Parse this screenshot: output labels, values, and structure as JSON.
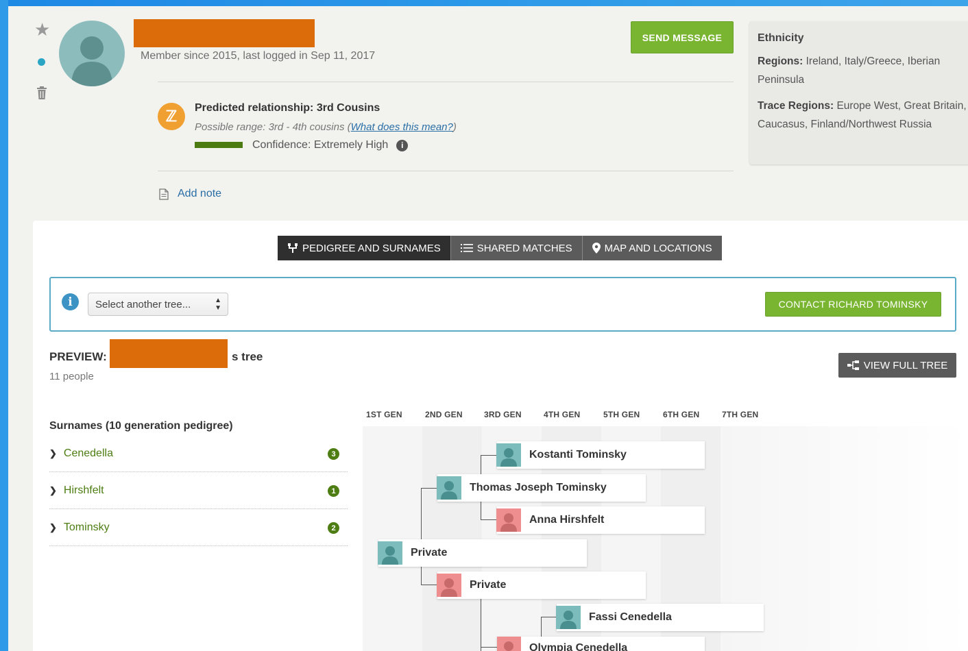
{
  "profile": {
    "member_since": "Member since 2015, last logged in Sep 11, 2017",
    "send_message": "SEND MESSAGE"
  },
  "relationship": {
    "predicted": "Predicted relationship: 3rd Cousins",
    "range_prefix": "Possible range: 3rd - 4th cousins (",
    "range_link": "What does this mean?",
    "range_suffix": ")",
    "confidence": "Confidence: Extremely High"
  },
  "note": {
    "add_note": "Add note"
  },
  "ethnicity": {
    "title": "Ethnicity",
    "regions_label": "Regions:",
    "regions": "Ireland, Italy/Greece, Iberian Peninsula",
    "trace_label": "Trace Regions:",
    "trace": "Europe West, Great Britain, Caucasus, Finland/Northwest Russia"
  },
  "tabs": [
    {
      "label": "PEDIGREE AND SURNAMES",
      "icon": "pedigree-icon",
      "active": true
    },
    {
      "label": "SHARED MATCHES",
      "icon": "list-icon",
      "active": false
    },
    {
      "label": "MAP AND LOCATIONS",
      "icon": "map-pin-icon",
      "active": false
    }
  ],
  "tree_select": {
    "value": "Select another tree...",
    "contact": "CONTACT RICHARD TOMINSKY"
  },
  "preview": {
    "prefix": "PREVIEW:",
    "suffix": "s tree",
    "people": "11 people",
    "view_full": "VIEW FULL TREE"
  },
  "surnames": {
    "title": "Surnames (10 generation pedigree)",
    "items": [
      {
        "name": "Cenedella",
        "count": "3"
      },
      {
        "name": "Hirshfelt",
        "count": "1"
      },
      {
        "name": "Tominsky",
        "count": "2"
      }
    ]
  },
  "generations": [
    "1ST GEN",
    "2ND GEN",
    "3RD GEN",
    "4TH GEN",
    "5TH GEN",
    "6TH GEN",
    "7TH GEN"
  ],
  "pedigree": [
    {
      "name": "Kostanti Tominsky",
      "gender": "male",
      "generation": 3
    },
    {
      "name": "Thomas Joseph Tominsky",
      "gender": "male",
      "generation": 2
    },
    {
      "name": "Anna Hirshfelt",
      "gender": "female",
      "generation": 3
    },
    {
      "name": "Private",
      "gender": "male",
      "generation": 1
    },
    {
      "name": "Private",
      "gender": "female",
      "generation": 2
    },
    {
      "name": "Fassi Cenedella",
      "gender": "male",
      "generation": 4
    },
    {
      "name": "Olympia Cenedella",
      "gender": "female",
      "generation": 3
    }
  ]
}
